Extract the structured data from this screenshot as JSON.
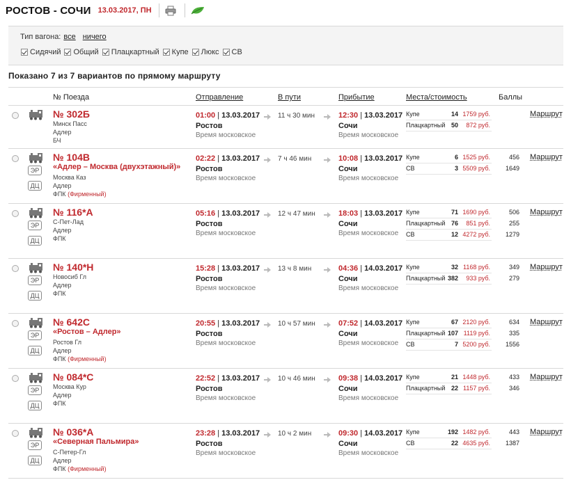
{
  "header": {
    "route": "РОСТОВ - СОЧИ",
    "date": "13.03.2017, ПН",
    "print_icon": "printer-icon",
    "eco_icon": "leaf-icon"
  },
  "filters": {
    "wagon_type_label": "Тип вагона:",
    "all_link": "все",
    "none_link": "ничего",
    "options": [
      "Сидячий",
      "Общий",
      "Плацкартный",
      "Купе",
      "Люкс",
      "СВ"
    ]
  },
  "summary": "Показано 7 из 7 вариантов по прямому маршруту",
  "columns": {
    "train": "№ Поезда",
    "departure": "Отправление",
    "on_way": "В пути",
    "arrival": "Прибытие",
    "seats": "Места/стоимость",
    "points": "Баллы"
  },
  "common": {
    "from_city": "Ростов",
    "to_city": "Сочи",
    "timezone": "Время московское",
    "route_link": "Маршрут",
    "badge_er": "ЭР",
    "badge_dc": "ДЦ"
  },
  "trains": [
    {
      "number": "№ 302Б",
      "name": "",
      "lines": [
        "Минск Пасс",
        "Адлер",
        "БЧ"
      ],
      "firm": "",
      "dep_time": "01:00",
      "dep_date": "13.03.2017",
      "duration": "11 ч 30 мин",
      "arr_time": "12:30",
      "arr_date": "13.03.2017",
      "seats": [
        {
          "type": "Купе",
          "count": "14",
          "price": "1759 руб.",
          "points": ""
        },
        {
          "type": "Плацкартный",
          "count": "50",
          "price": "872 руб.",
          "points": ""
        }
      ],
      "badges": false
    },
    {
      "number": "№ 104В",
      "name": "«Адлер – Москва (двухэтажный)»",
      "lines": [
        "Москва Каз",
        "Адлер",
        "ФПК"
      ],
      "firm": "(Фирменный)",
      "dep_time": "02:22",
      "dep_date": "13.03.2017",
      "duration": "7 ч 46 мин",
      "arr_time": "10:08",
      "arr_date": "13.03.2017",
      "seats": [
        {
          "type": "Купе",
          "count": "6",
          "price": "1525 руб.",
          "points": "456"
        },
        {
          "type": "СВ",
          "count": "3",
          "price": "5509 руб.",
          "points": "1649"
        }
      ],
      "badges": true
    },
    {
      "number": "№ 116*А",
      "name": "",
      "lines": [
        "С-Пет-Лад",
        "Адлер",
        "ФПК"
      ],
      "firm": "",
      "dep_time": "05:16",
      "dep_date": "13.03.2017",
      "duration": "12 ч 47 мин",
      "arr_time": "18:03",
      "arr_date": "13.03.2017",
      "seats": [
        {
          "type": "Купе",
          "count": "71",
          "price": "1690 руб.",
          "points": "506"
        },
        {
          "type": "Плацкартный",
          "count": "76",
          "price": "851 руб.",
          "points": "255"
        },
        {
          "type": "СВ",
          "count": "12",
          "price": "4272 руб.",
          "points": "1279"
        }
      ],
      "badges": true
    },
    {
      "number": "№ 140*Н",
      "name": "",
      "lines": [
        "Новосиб Гл",
        "Адлер",
        "ФПК"
      ],
      "firm": "",
      "dep_time": "15:28",
      "dep_date": "13.03.2017",
      "duration": "13 ч 8 мин",
      "arr_time": "04:36",
      "arr_date": "14.03.2017",
      "seats": [
        {
          "type": "Купе",
          "count": "32",
          "price": "1168 руб.",
          "points": "349"
        },
        {
          "type": "Плацкартный",
          "count": "382",
          "price": "933 руб.",
          "points": "279"
        }
      ],
      "badges": true
    },
    {
      "number": "№ 642С",
      "name": "«Ростов – Адлер»",
      "lines": [
        "Ростов Гл",
        "Адлер",
        "ФПК"
      ],
      "firm": "(Фирменный)",
      "dep_time": "20:55",
      "dep_date": "13.03.2017",
      "duration": "10 ч 57 мин",
      "arr_time": "07:52",
      "arr_date": "14.03.2017",
      "seats": [
        {
          "type": "Купе",
          "count": "67",
          "price": "2120 руб.",
          "points": "634"
        },
        {
          "type": "Плацкартный",
          "count": "107",
          "price": "1119 руб.",
          "points": "335"
        },
        {
          "type": "СВ",
          "count": "7",
          "price": "5200 руб.",
          "points": "1556"
        }
      ],
      "badges": true
    },
    {
      "number": "№ 084*С",
      "name": "",
      "lines": [
        "Москва Кур",
        "Адлер",
        "ФПК"
      ],
      "firm": "",
      "dep_time": "22:52",
      "dep_date": "13.03.2017",
      "duration": "10 ч 46 мин",
      "arr_time": "09:38",
      "arr_date": "14.03.2017",
      "seats": [
        {
          "type": "Купе",
          "count": "21",
          "price": "1448 руб.",
          "points": "433"
        },
        {
          "type": "Плацкартный",
          "count": "22",
          "price": "1157 руб.",
          "points": "346"
        }
      ],
      "badges": true
    },
    {
      "number": "№ 036*А",
      "name": "«Северная Пальмира»",
      "lines": [
        "С-Петер-Гл",
        "Адлер",
        "ФПК"
      ],
      "firm": "(Фирменный)",
      "dep_time": "23:28",
      "dep_date": "13.03.2017",
      "duration": "10 ч 2 мин",
      "arr_time": "09:30",
      "arr_date": "14.03.2017",
      "seats": [
        {
          "type": "Купе",
          "count": "192",
          "price": "1482 руб.",
          "points": "443"
        },
        {
          "type": "СВ",
          "count": "22",
          "price": "4635 руб.",
          "points": "1387"
        }
      ],
      "badges": true
    }
  ]
}
